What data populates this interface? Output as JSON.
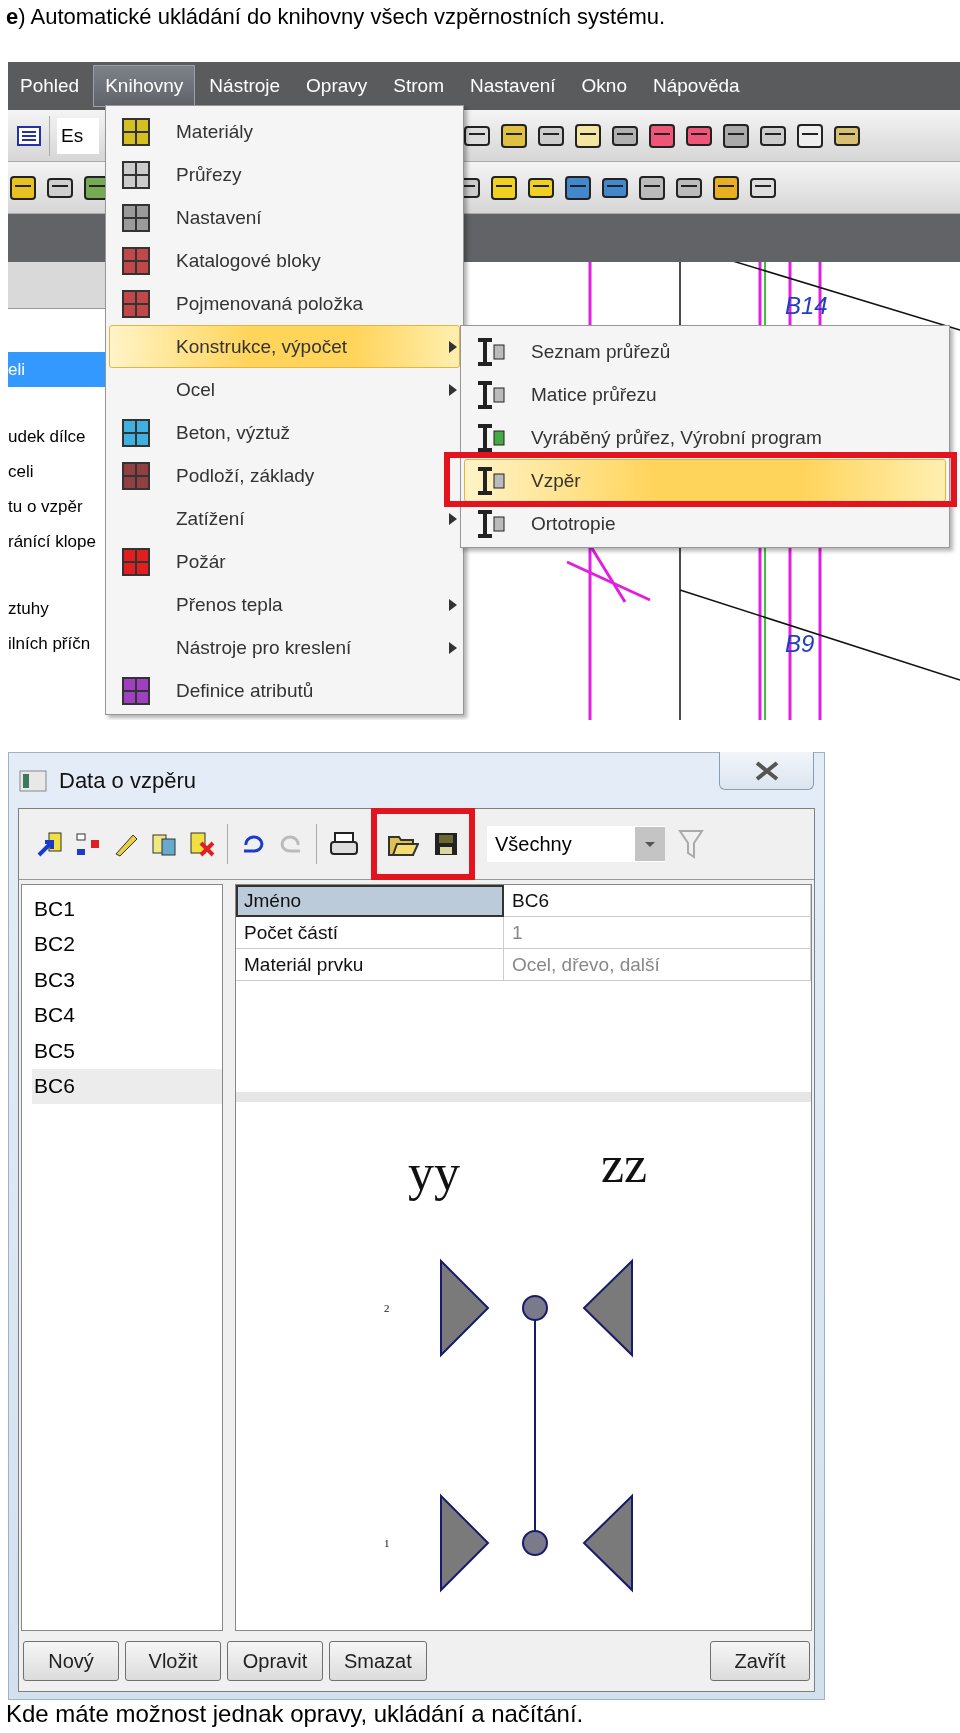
{
  "caption_top": "**e**) Automatické ukládání do knihovny všech vzpěrnostních systému.",
  "app": {
    "menubar": [
      {
        "label": "Pohled",
        "selected": false
      },
      {
        "label": "Knihovny",
        "selected": true
      },
      {
        "label": "Nástroje",
        "selected": false
      },
      {
        "label": "Opravy",
        "selected": false
      },
      {
        "label": "Strom",
        "selected": false
      },
      {
        "label": "Nastavení",
        "selected": false
      },
      {
        "label": "Okno",
        "selected": false
      },
      {
        "label": "Nápověda",
        "selected": false
      }
    ],
    "toolbar_field": {
      "value": "Es"
    },
    "side_panel": {
      "groups": [
        [
          {
            "label": "eli",
            "selected": true
          }
        ],
        [
          {
            "label": "udek dílce",
            "selected": false
          },
          {
            "label": "celi",
            "selected": false
          },
          {
            "label": "tu o vzpěr",
            "selected": false
          },
          {
            "label": "ránící klope",
            "selected": false
          }
        ],
        [
          {
            "label": "ztuhy",
            "selected": false
          },
          {
            "label": "ilních příčn",
            "selected": false
          }
        ]
      ]
    },
    "canvas": {
      "labels": [
        "B14",
        "B9"
      ]
    },
    "menu": {
      "items": [
        {
          "label": "Materiály",
          "has_icon": true,
          "submenu": false,
          "selected": false
        },
        {
          "label": "Průřezy",
          "has_icon": true,
          "submenu": false,
          "selected": false
        },
        {
          "label": "Nastavení",
          "has_icon": true,
          "submenu": false,
          "selected": false
        },
        {
          "label": "Katalogové bloky",
          "has_icon": true,
          "submenu": false,
          "selected": false
        },
        {
          "label": "Pojmenovaná položka",
          "has_icon": true,
          "submenu": false,
          "selected": false
        },
        {
          "label": "Konstrukce, výpočet",
          "has_icon": false,
          "submenu": true,
          "selected": true
        },
        {
          "label": "Ocel",
          "has_icon": false,
          "submenu": true,
          "selected": false
        },
        {
          "label": "Beton, výztuž",
          "has_icon": true,
          "submenu": false,
          "selected": false
        },
        {
          "label": "Podloží, základy",
          "has_icon": true,
          "submenu": false,
          "selected": false
        },
        {
          "label": "Zatížení",
          "has_icon": false,
          "submenu": true,
          "selected": false
        },
        {
          "label": "Požár",
          "has_icon": true,
          "submenu": false,
          "selected": false
        },
        {
          "label": "Přenos tepla",
          "has_icon": false,
          "submenu": true,
          "selected": false
        },
        {
          "label": "Nástroje pro kreslení",
          "has_icon": false,
          "submenu": true,
          "selected": false
        },
        {
          "label": "Definice atributů",
          "has_icon": true,
          "submenu": false,
          "selected": false
        }
      ]
    },
    "submenu": {
      "items": [
        {
          "label": "Seznam průřezů",
          "selected": false,
          "annotated": false
        },
        {
          "label": "Matice průřezu",
          "selected": false,
          "annotated": false
        },
        {
          "label": "Vyráběný průřez, Výrobní program",
          "selected": false,
          "annotated": false
        },
        {
          "label": "Vzpěr",
          "selected": true,
          "annotated": true
        },
        {
          "label": "Ortotropie",
          "selected": false,
          "annotated": false
        }
      ]
    }
  },
  "dialog": {
    "title": "Data o vzpěru",
    "file_buttons_annotated": true,
    "filter": {
      "value": "Všechny"
    },
    "list": [
      {
        "label": "BC1",
        "selected": false
      },
      {
        "label": "BC2",
        "selected": false
      },
      {
        "label": "BC3",
        "selected": false
      },
      {
        "label": "BC4",
        "selected": false
      },
      {
        "label": "BC5",
        "selected": false
      },
      {
        "label": "BC6",
        "selected": true
      }
    ],
    "properties": [
      {
        "name": "Jméno",
        "value": "BC6",
        "selected": true,
        "disabled": false
      },
      {
        "name": "Počet částí",
        "value": "1",
        "selected": false,
        "disabled": true
      },
      {
        "name": "Materiál prvku",
        "value": "Ocel, dřevo, další",
        "selected": false,
        "disabled": true
      }
    ],
    "diagram": {
      "axes": [
        "yy",
        "zz"
      ],
      "nodes": [
        "2",
        "1"
      ]
    },
    "buttons": [
      {
        "label": "Nový",
        "kind": "action"
      },
      {
        "label": "Vložit",
        "kind": "action"
      },
      {
        "label": "Opravit",
        "kind": "action"
      },
      {
        "label": "Smazat",
        "kind": "action"
      },
      {
        "label": "Zavřít",
        "kind": "close"
      }
    ]
  },
  "caption_bottom": "Kde máte možnost jednak opravy, ukládání a načítání."
}
